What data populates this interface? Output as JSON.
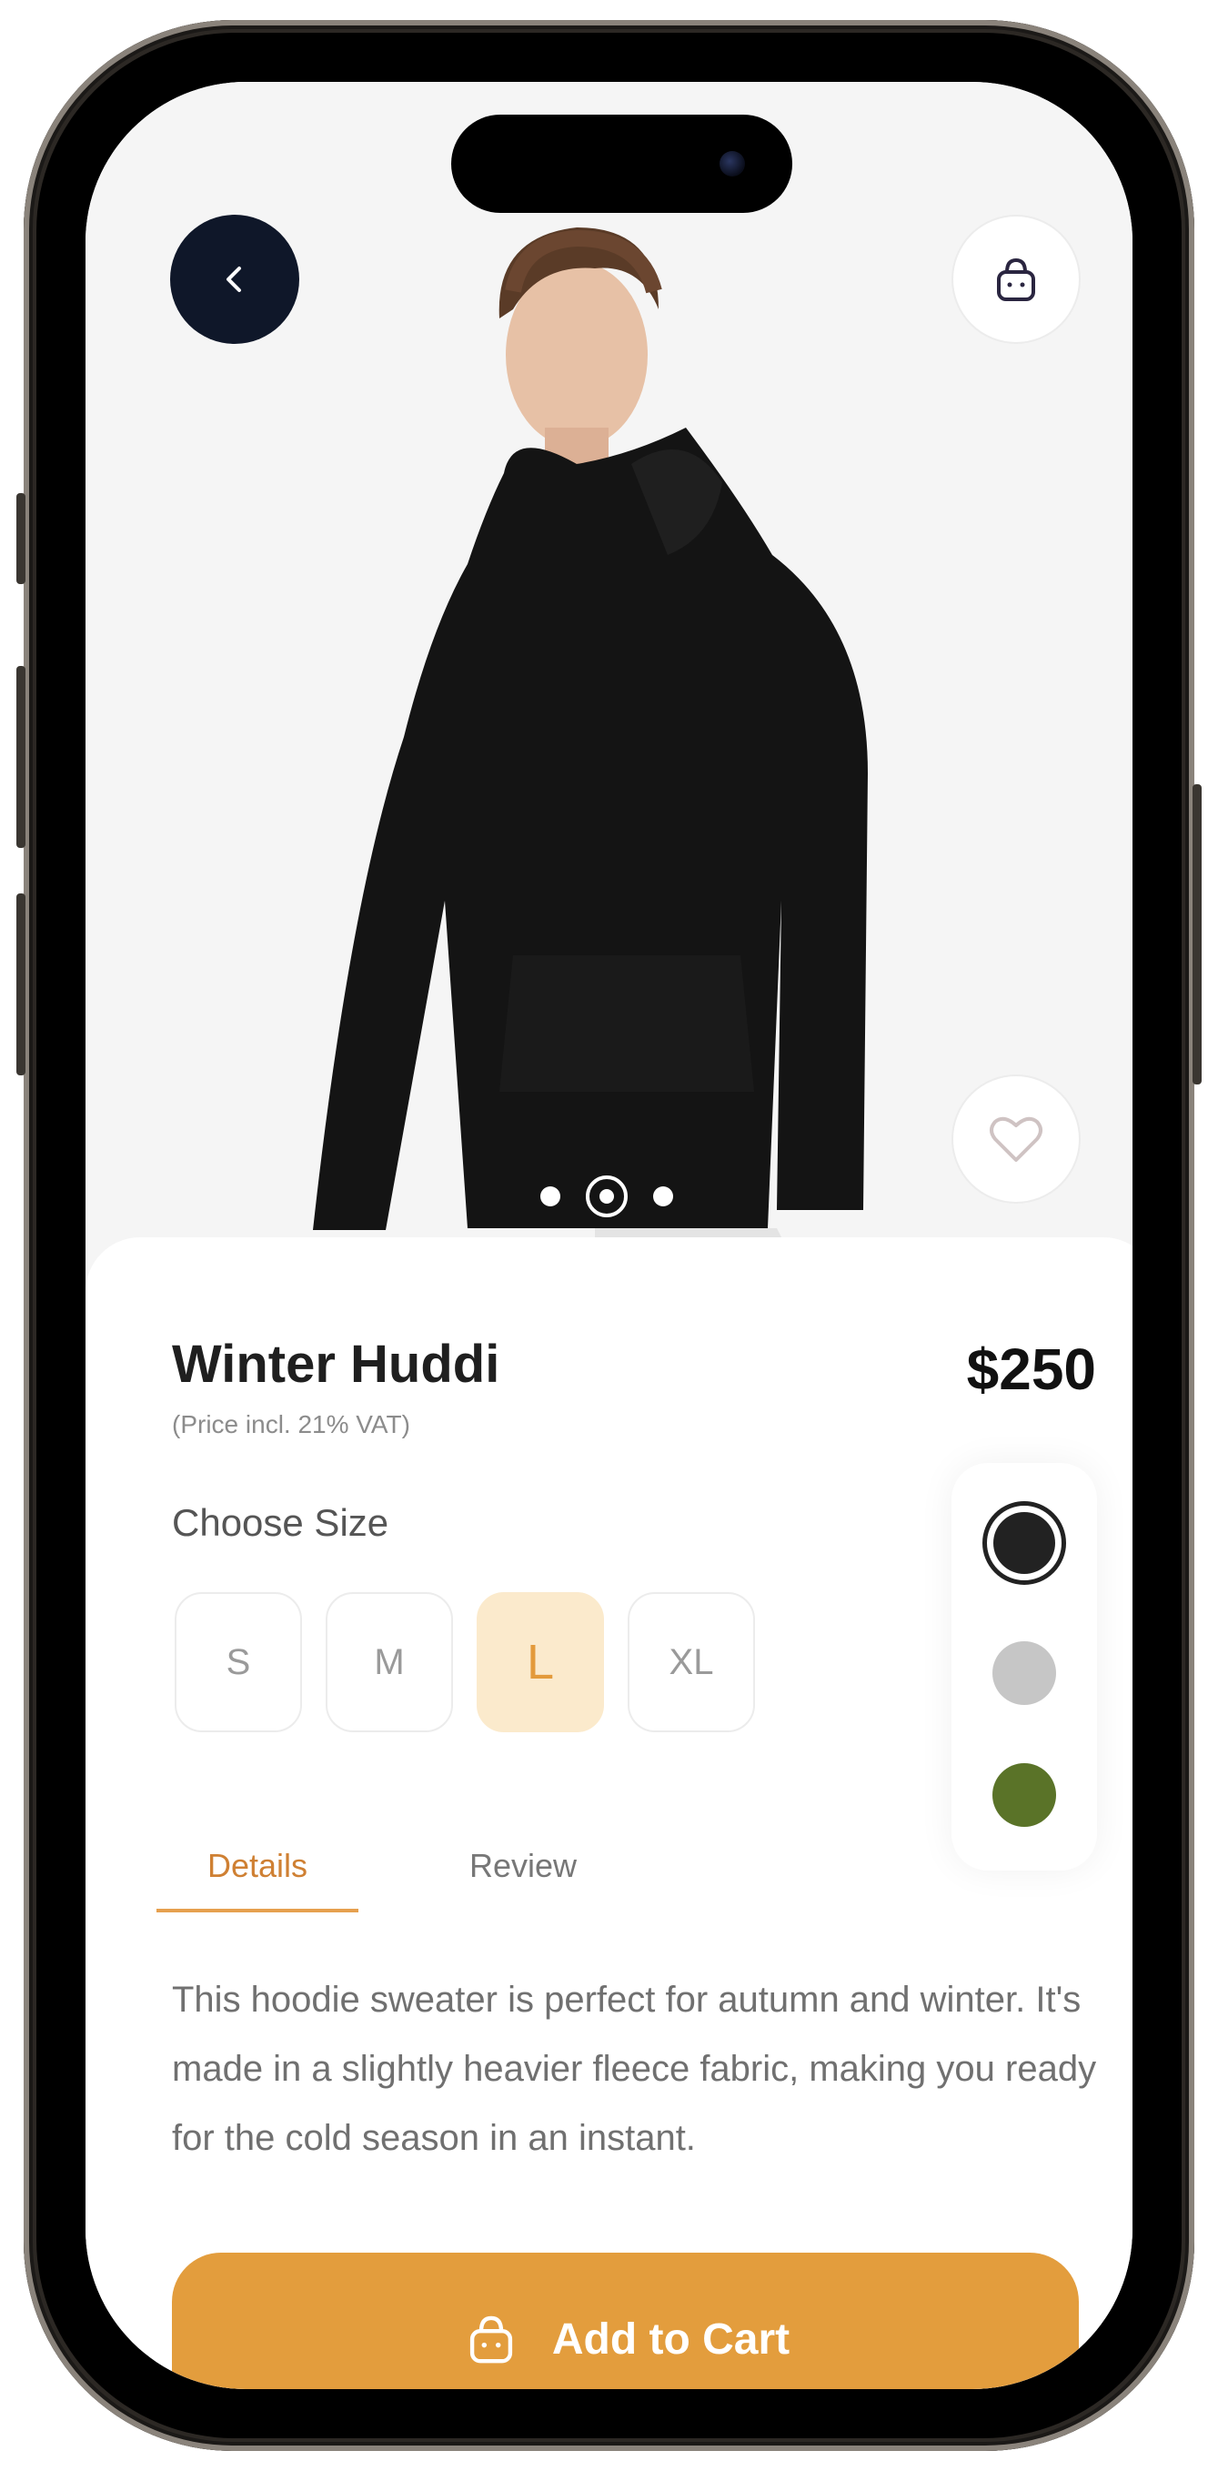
{
  "product": {
    "name": "Winter Huddi",
    "price": "$250",
    "vat_note": "(Price incl. 21% VAT)"
  },
  "size_section": {
    "label": "Choose Size",
    "options": [
      "S",
      "M",
      "L",
      "XL"
    ],
    "selected": "L"
  },
  "colors": [
    {
      "hex": "#222222",
      "selected": true
    },
    {
      "hex": "#c6c6c6",
      "selected": false
    },
    {
      "hex": "#5a7328",
      "selected": false
    }
  ],
  "tabs": [
    {
      "label": "Details",
      "active": true
    },
    {
      "label": "Review",
      "active": false
    }
  ],
  "description": "This hoodie sweater is perfect for autumn and winter. It's made in a slightly heavier fleece fabric, making you ready for the cold season in an instant.",
  "cta": {
    "label": "Add to Cart",
    "icon": "bag-icon"
  },
  "image_carousel": {
    "count": 3,
    "active_index": 2
  },
  "theme": {
    "accent": "#e39d3d",
    "accent_light": "#fbeacc",
    "dark": "#0f1729"
  }
}
